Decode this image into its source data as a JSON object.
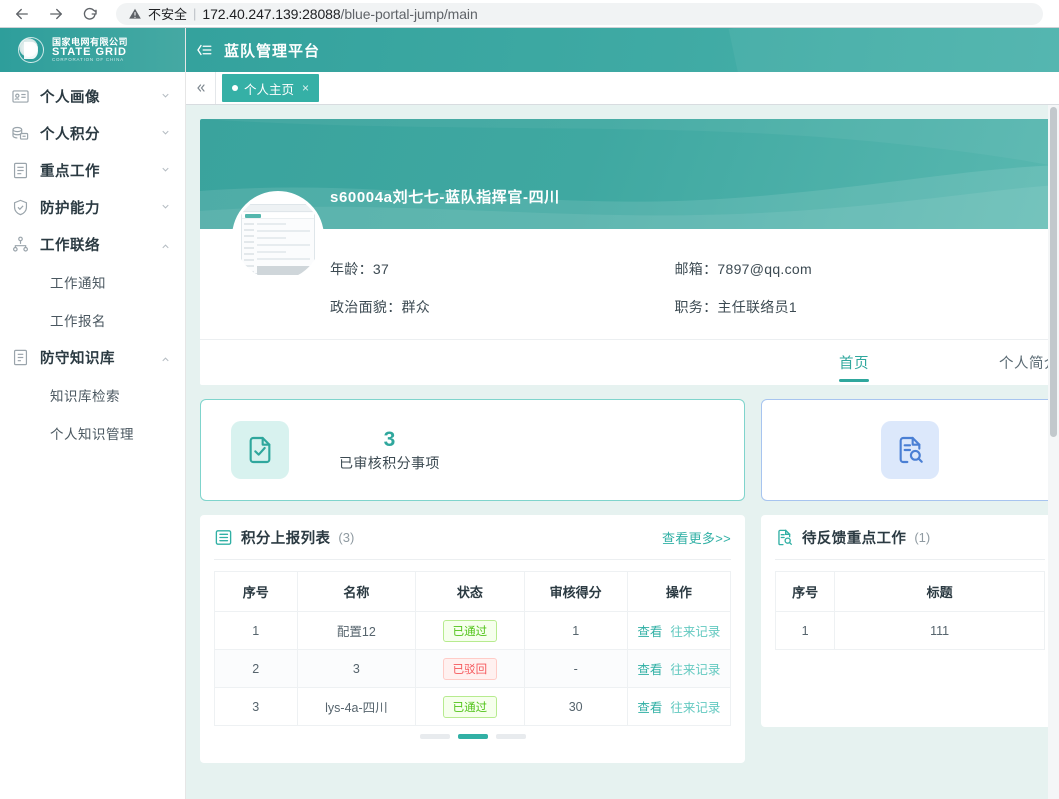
{
  "browser": {
    "back_icon": "arrow-left-icon",
    "forward_icon": "arrow-right-icon",
    "reload_icon": "reload-icon",
    "security_icon": "warning-triangle-icon",
    "security_label": "不安全",
    "separator": "|",
    "url_host": "172.40.247.139:28088",
    "url_path": "/blue-portal-jump/main"
  },
  "sidebar": {
    "logo": {
      "cn_name": "国家电网有限公司",
      "en_name": "STATE  GRID",
      "sub_name": "CORPORATION OF CHINA"
    },
    "items": [
      {
        "label": "个人画像",
        "icon": "id-card-icon",
        "arrow": "chevron-down-icon",
        "expanded": false
      },
      {
        "label": "个人积分",
        "icon": "coins-icon",
        "arrow": "chevron-down-icon",
        "expanded": false
      },
      {
        "label": "重点工作",
        "icon": "document-icon",
        "arrow": "chevron-down-icon",
        "expanded": false
      },
      {
        "label": "防护能力",
        "icon": "shield-check-icon",
        "arrow": "chevron-down-icon",
        "expanded": false
      },
      {
        "label": "工作联络",
        "icon": "sitemap-icon",
        "arrow": "chevron-up-icon",
        "expanded": true,
        "children": [
          "工作通知",
          "工作报名"
        ]
      },
      {
        "label": "防守知识库",
        "icon": "book-icon",
        "arrow": "chevron-up-icon",
        "expanded": true,
        "children": [
          "知识库检索",
          "个人知识管理"
        ]
      }
    ]
  },
  "topbar": {
    "collapse_icon": "menu-collapse-icon",
    "title": "蓝队管理平台"
  },
  "tabbar": {
    "scroll_left_icon": "double-chevron-left-icon",
    "tabs": [
      {
        "label": "个人主页",
        "active": true,
        "close": "×"
      }
    ]
  },
  "profile": {
    "name": "s60004a刘七七-蓝队指挥官-四川",
    "avatar_alt": "avatar",
    "fields": [
      {
        "label": "年龄：",
        "value": "37"
      },
      {
        "label": "政治面貌：",
        "value": "群众"
      },
      {
        "label": "邮箱：",
        "value": "7897@qq.com"
      },
      {
        "label": "职务：",
        "value": "主任联络员1"
      }
    ],
    "tabs": [
      {
        "label": "首页",
        "active": true
      },
      {
        "label": "个人简介",
        "active": false
      }
    ]
  },
  "stats": [
    {
      "icon": "document-check-icon",
      "number": "3",
      "label": "已审核积分事项",
      "accent": "#2fa79d"
    },
    {
      "icon": "document-search-icon",
      "number": "",
      "label": "",
      "accent": "#4a7fd4"
    }
  ],
  "panels": {
    "score_list": {
      "icon": "list-icon",
      "title": "积分上报列表",
      "count": "(3)",
      "more_label": "查看更多>>",
      "columns": [
        "序号",
        "名称",
        "状态",
        "审核得分",
        "操作"
      ],
      "rows": [
        {
          "index": "1",
          "name": "配置12",
          "status": "已通过",
          "status_type": "success",
          "score": "1",
          "action_primary": "查看",
          "action_secondary": "往来记录"
        },
        {
          "index": "2",
          "name": "3",
          "status": "已驳回",
          "status_type": "danger",
          "score": "-",
          "action_primary": "查看",
          "action_secondary": "往来记录"
        },
        {
          "index": "3",
          "name": "lys-4a-四川",
          "status": "已通过",
          "status_type": "success",
          "score": "30",
          "action_primary": "查看",
          "action_secondary": "往来记录"
        }
      ]
    },
    "pending_work": {
      "icon": "document-search-icon",
      "title": "待反馈重点工作",
      "count": "(1)",
      "columns": [
        "序号",
        "标题"
      ],
      "rows": [
        {
          "index": "1",
          "title": "111"
        }
      ]
    }
  },
  "colors": {
    "brand_teal": "#2fa79d",
    "header_gradient_start": "#34a29d",
    "header_gradient_end": "#4cb3ac",
    "content_bg": "#e6f2f0",
    "success": "#52c41a",
    "danger": "#f5585c",
    "blue_accent": "#4a7fd4"
  }
}
